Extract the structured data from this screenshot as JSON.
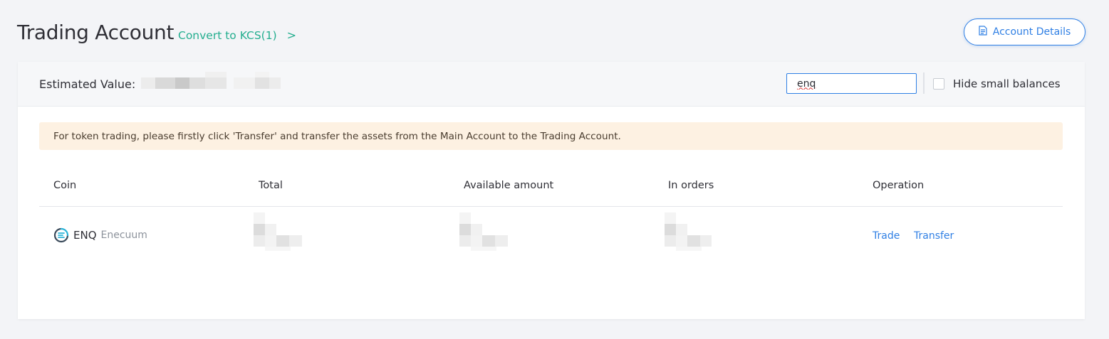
{
  "header": {
    "title": "Trading Account",
    "convert_label": "Convert to KCS(1)",
    "convert_chevron": ">",
    "details_button": "Account Details",
    "details_icon": "document-icon"
  },
  "summary": {
    "estimated_label": "Estimated Value:",
    "search_value": "enq",
    "hide_small_label": "Hide small balances",
    "hide_small_checked": false
  },
  "notice": {
    "text": "For token trading, please firstly click 'Transfer' and transfer the assets from the Main Account to the Trading Account."
  },
  "table": {
    "columns": [
      "Coin",
      "Total",
      "Available amount",
      "In orders",
      "Operation"
    ],
    "rows": [
      {
        "coin_code": "ENQ",
        "coin_name": "Enecuum",
        "coin_icon": "enecuum-logo-icon",
        "actions": [
          "Trade",
          "Transfer"
        ]
      }
    ]
  },
  "colors": {
    "accent_blue": "#2f7fe4",
    "accent_green": "#24ae8f",
    "notice_bg": "#fdf1e2"
  }
}
